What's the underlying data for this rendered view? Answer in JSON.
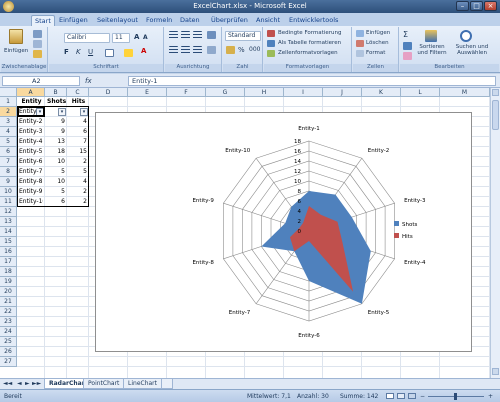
{
  "window": {
    "title": "ExcelChart.xlsx - Microsoft Excel"
  },
  "tabs": [
    "Start",
    "Einfügen",
    "Seitenlayout",
    "Formeln",
    "Daten",
    "Überprüfen",
    "Ansicht",
    "Entwicklertools"
  ],
  "ribbon": {
    "clipboard": {
      "paste": "Einfügen",
      "label": "Zwischenablage"
    },
    "font": {
      "name": "Calibri",
      "size": "11",
      "label": "Schriftart"
    },
    "alignment": {
      "label": "Ausrichtung"
    },
    "number": {
      "format": "Standard",
      "label": "Zahl"
    },
    "styles": {
      "cond": "Bedingte Formatierung",
      "table": "Als Tabelle formatieren",
      "cell": "Zellenformatvorlagen",
      "label": "Formatvorlagen"
    },
    "cells": {
      "insert": "Einfügen",
      "delete": "Löschen",
      "format": "Format",
      "label": "Zellen"
    },
    "editing": {
      "sort": "Sortieren und Filtern",
      "find": "Suchen und Auswählen",
      "label": "Bearbeiten"
    }
  },
  "formula_bar": {
    "name_box": "A2",
    "fx": "fx",
    "content": "Entity-1"
  },
  "columns": [
    "A",
    "B",
    "C",
    "D",
    "E",
    "F",
    "G",
    "H",
    "I",
    "J",
    "K",
    "L",
    "M"
  ],
  "rows": [
    "1",
    "2",
    "3",
    "4",
    "5",
    "6",
    "7",
    "8",
    "9",
    "10",
    "11",
    "12",
    "13",
    "14",
    "15",
    "16",
    "17",
    "18",
    "19",
    "20",
    "21",
    "22",
    "23",
    "24",
    "25",
    "26",
    "27"
  ],
  "table": {
    "headers": [
      "Entity",
      "Shots",
      "Hits"
    ],
    "data": [
      [
        "Entity-1",
        "8",
        "5"
      ],
      [
        "Entity-2",
        "9",
        "4"
      ],
      [
        "Entity-3",
        "9",
        "6"
      ],
      [
        "Entity-4",
        "13",
        "7"
      ],
      [
        "Entity-5",
        "18",
        "15"
      ],
      [
        "Entity-6",
        "10",
        "2"
      ],
      [
        "Entity-7",
        "5",
        "5"
      ],
      [
        "Entity-8",
        "10",
        "4"
      ],
      [
        "Entity-9",
        "5",
        "2"
      ],
      [
        "Entity-10",
        "6",
        "2"
      ]
    ]
  },
  "chart_data": {
    "type": "radar",
    "categories": [
      "Entity-1",
      "Entity-2",
      "Entity-3",
      "Entity-4",
      "Entity-5",
      "Entity-6",
      "Entity-7",
      "Entity-8",
      "Entity-9",
      "Entity-10"
    ],
    "series": [
      {
        "name": "Shots",
        "values": [
          8,
          9,
          9,
          13,
          18,
          10,
          5,
          10,
          5,
          6
        ],
        "color": "#4f81bd"
      },
      {
        "name": "Hits",
        "values": [
          5,
          4,
          6,
          7,
          15,
          2,
          5,
          4,
          2,
          2
        ],
        "color": "#c0504d"
      }
    ],
    "ticks": [
      "0",
      "2",
      "4",
      "6",
      "8",
      "10",
      "12",
      "14",
      "16",
      "18"
    ],
    "rmax": 18,
    "legend": "right"
  },
  "sheets": [
    "RadarChart",
    "PointChart",
    "LineChart"
  ],
  "active_sheet": "RadarChart",
  "status": {
    "ready": "Bereit",
    "average": "Mittelwert: 7,1",
    "count": "Anzahl: 30",
    "sum": "Summe: 142"
  }
}
